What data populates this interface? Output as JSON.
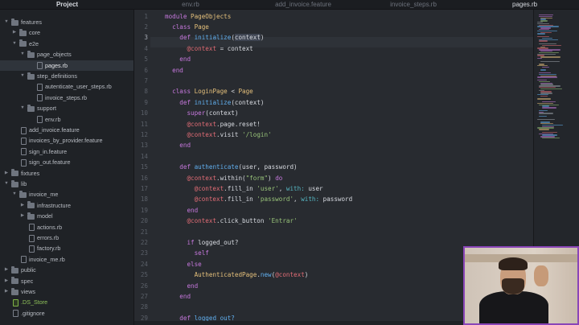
{
  "tabs": [
    {
      "label": "Project",
      "active": true
    },
    {
      "label": "env.rb",
      "active": false
    },
    {
      "label": "add_invoice.feature",
      "active": false
    },
    {
      "label": "invoice_steps.rb",
      "active": false
    },
    {
      "label": "pages.rb",
      "active": true
    }
  ],
  "sidebar": {
    "items": [
      {
        "label": "features",
        "type": "folder",
        "expanded": true,
        "depth": 1
      },
      {
        "label": "core",
        "type": "folder",
        "expanded": false,
        "depth": 2
      },
      {
        "label": "e2e",
        "type": "folder",
        "expanded": true,
        "depth": 2
      },
      {
        "label": "page_objects",
        "type": "folder",
        "expanded": true,
        "depth": 3
      },
      {
        "label": "pages.rb",
        "type": "file",
        "depth": 4,
        "selected": true
      },
      {
        "label": "step_definitions",
        "type": "folder",
        "expanded": true,
        "depth": 3
      },
      {
        "label": "autenticate_user_steps.rb",
        "type": "file",
        "depth": 4
      },
      {
        "label": "invoice_steps.rb",
        "type": "file",
        "depth": 4
      },
      {
        "label": "support",
        "type": "folder",
        "expanded": true,
        "depth": 3
      },
      {
        "label": "env.rb",
        "type": "file",
        "depth": 4
      },
      {
        "label": "add_invoice.feature",
        "type": "file",
        "depth": 2
      },
      {
        "label": "invoices_by_provider.feature",
        "type": "file",
        "depth": 2
      },
      {
        "label": "sign_in.feature",
        "type": "file",
        "depth": 2
      },
      {
        "label": "sign_out.feature",
        "type": "file",
        "depth": 2
      },
      {
        "label": "fixtures",
        "type": "folder",
        "expanded": false,
        "depth": 1
      },
      {
        "label": "lib",
        "type": "folder",
        "expanded": true,
        "depth": 1
      },
      {
        "label": "invoice_me",
        "type": "folder",
        "expanded": true,
        "depth": 2
      },
      {
        "label": "infrastructure",
        "type": "folder",
        "expanded": false,
        "depth": 3
      },
      {
        "label": "model",
        "type": "folder",
        "expanded": false,
        "depth": 3
      },
      {
        "label": "actions.rb",
        "type": "file",
        "depth": 3
      },
      {
        "label": "errors.rb",
        "type": "file",
        "depth": 3
      },
      {
        "label": "factory.rb",
        "type": "file",
        "depth": 3
      },
      {
        "label": "invoice_me.rb",
        "type": "file",
        "depth": 2
      },
      {
        "label": "public",
        "type": "folder",
        "expanded": false,
        "depth": 1
      },
      {
        "label": "spec",
        "type": "folder",
        "expanded": false,
        "depth": 1
      },
      {
        "label": "views",
        "type": "folder",
        "expanded": false,
        "depth": 1
      },
      {
        "label": ".DS_Store",
        "type": "file",
        "depth": 1,
        "highlight": true
      },
      {
        "label": ".gitignore",
        "type": "file",
        "depth": 1
      }
    ]
  },
  "editor": {
    "current_line": 3,
    "lines": [
      {
        "n": "1",
        "tokens": [
          [
            "kw",
            "module "
          ],
          [
            "cls",
            "PageObjects"
          ]
        ]
      },
      {
        "n": "2",
        "tokens": [
          [
            "",
            "  "
          ],
          [
            "kw",
            "class "
          ],
          [
            "cls",
            "Page"
          ]
        ]
      },
      {
        "n": "3",
        "tokens": [
          [
            "",
            "    "
          ],
          [
            "kw",
            "def "
          ],
          [
            "fn",
            "initialize"
          ],
          [
            "",
            "("
          ],
          [
            "sel",
            "context"
          ],
          [
            "",
            ")"
          ]
        ]
      },
      {
        "n": "4",
        "tokens": [
          [
            "",
            "      "
          ],
          [
            "ivar",
            "@context"
          ],
          [
            "",
            " = context"
          ]
        ]
      },
      {
        "n": "5",
        "tokens": [
          [
            "",
            "    "
          ],
          [
            "kw",
            "end"
          ]
        ]
      },
      {
        "n": "6",
        "tokens": [
          [
            "",
            "  "
          ],
          [
            "kw",
            "end"
          ]
        ]
      },
      {
        "n": "7",
        "tokens": []
      },
      {
        "n": "8",
        "tokens": [
          [
            "",
            "  "
          ],
          [
            "kw",
            "class "
          ],
          [
            "cls",
            "LoginPage"
          ],
          [
            "",
            " < "
          ],
          [
            "cls",
            "Page"
          ]
        ]
      },
      {
        "n": "9",
        "tokens": [
          [
            "",
            "    "
          ],
          [
            "kw",
            "def "
          ],
          [
            "fn",
            "initialize"
          ],
          [
            "",
            "(context)"
          ]
        ]
      },
      {
        "n": "10",
        "tokens": [
          [
            "",
            "      "
          ],
          [
            "kw",
            "super"
          ],
          [
            "",
            "(context)"
          ]
        ]
      },
      {
        "n": "11",
        "tokens": [
          [
            "",
            "      "
          ],
          [
            "ivar",
            "@context"
          ],
          [
            "",
            ".page.reset!"
          ]
        ]
      },
      {
        "n": "12",
        "tokens": [
          [
            "",
            "      "
          ],
          [
            "ivar",
            "@context"
          ],
          [
            "",
            ".visit "
          ],
          [
            "str",
            "'/login'"
          ]
        ]
      },
      {
        "n": "13",
        "tokens": [
          [
            "",
            "    "
          ],
          [
            "kw",
            "end"
          ]
        ]
      },
      {
        "n": "14",
        "tokens": []
      },
      {
        "n": "15",
        "tokens": [
          [
            "",
            "    "
          ],
          [
            "kw",
            "def "
          ],
          [
            "fn",
            "authenticate"
          ],
          [
            "",
            "(user, password)"
          ]
        ]
      },
      {
        "n": "16",
        "tokens": [
          [
            "",
            "      "
          ],
          [
            "ivar",
            "@context"
          ],
          [
            "",
            ".within("
          ],
          [
            "str",
            "\"form\""
          ],
          [
            "",
            ") "
          ],
          [
            "kw",
            "do"
          ]
        ]
      },
      {
        "n": "17",
        "tokens": [
          [
            "",
            "        "
          ],
          [
            "ivar",
            "@context"
          ],
          [
            "",
            ".fill_in "
          ],
          [
            "str",
            "'user'"
          ],
          [
            "",
            ", "
          ],
          [
            "sym",
            "with:"
          ],
          [
            "",
            " user"
          ]
        ]
      },
      {
        "n": "18",
        "tokens": [
          [
            "",
            "        "
          ],
          [
            "ivar",
            "@context"
          ],
          [
            "",
            ".fill_in "
          ],
          [
            "str",
            "'password'"
          ],
          [
            "",
            ", "
          ],
          [
            "sym",
            "with:"
          ],
          [
            "",
            " password"
          ]
        ]
      },
      {
        "n": "19",
        "tokens": [
          [
            "",
            "      "
          ],
          [
            "kw",
            "end"
          ]
        ]
      },
      {
        "n": "20",
        "tokens": [
          [
            "",
            "      "
          ],
          [
            "ivar",
            "@context"
          ],
          [
            "",
            ".click_button "
          ],
          [
            "str",
            "'Entrar'"
          ]
        ]
      },
      {
        "n": "21",
        "tokens": []
      },
      {
        "n": "22",
        "tokens": [
          [
            "",
            "      "
          ],
          [
            "kw",
            "if "
          ],
          [
            "",
            "logged_out?"
          ]
        ]
      },
      {
        "n": "23",
        "tokens": [
          [
            "",
            "        "
          ],
          [
            "kw",
            "self"
          ]
        ]
      },
      {
        "n": "24",
        "tokens": [
          [
            "",
            "      "
          ],
          [
            "kw",
            "else"
          ]
        ]
      },
      {
        "n": "25",
        "tokens": [
          [
            "",
            "        "
          ],
          [
            "cls",
            "AuthenticatedPage"
          ],
          [
            "",
            "."
          ],
          [
            "fn",
            "new"
          ],
          [
            "",
            "("
          ],
          [
            "ivar",
            "@context"
          ],
          [
            "",
            ")"
          ]
        ]
      },
      {
        "n": "26",
        "tokens": [
          [
            "",
            "      "
          ],
          [
            "kw",
            "end"
          ]
        ]
      },
      {
        "n": "27",
        "tokens": [
          [
            "",
            "    "
          ],
          [
            "kw",
            "end"
          ]
        ]
      },
      {
        "n": "28",
        "tokens": []
      },
      {
        "n": "29",
        "tokens": [
          [
            "",
            "    "
          ],
          [
            "kw",
            "def "
          ],
          [
            "fn",
            "logged_out?"
          ]
        ]
      }
    ]
  },
  "colors": {
    "accent_webcam_border": "#8a45b8",
    "keyword": "#c678dd",
    "class": "#e5c07b",
    "function": "#61afef",
    "string": "#98c379",
    "ivar": "#e06c75"
  }
}
